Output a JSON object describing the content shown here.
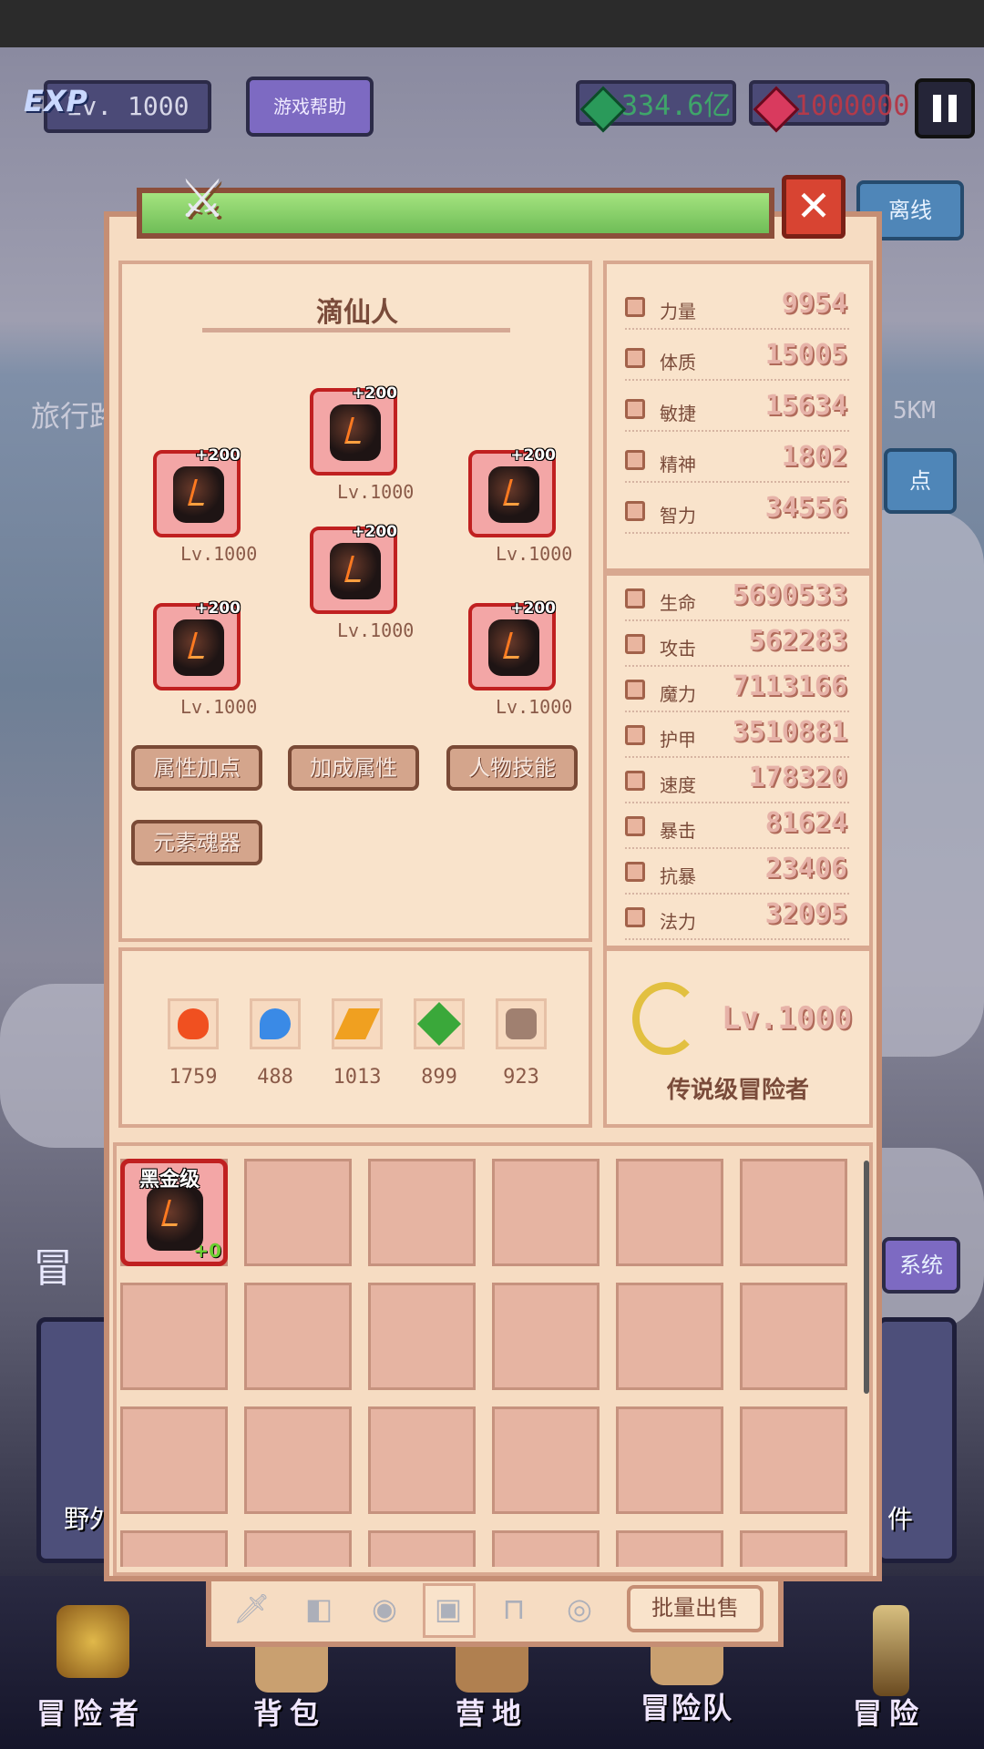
{
  "topbar": {
    "exp_label": "EXP",
    "level": "Lv. 1000",
    "help_label": "游戏帮助",
    "currency_green": "334.6亿",
    "currency_red": "1000000"
  },
  "background": {
    "offline_label": "离线",
    "travel_label": "旅行路",
    "distance": "5KM",
    "point_label": "点",
    "adventure_partial": "冒",
    "system_label": "系统",
    "left_card_label": "野外",
    "right_card_label": "件"
  },
  "character": {
    "name": "滴仙人",
    "equipment": [
      {
        "id": "weapon",
        "plus": "+200",
        "level": "Lv.1000"
      },
      {
        "id": "helmet",
        "plus": "+200",
        "level": "Lv.1000"
      },
      {
        "id": "shield",
        "plus": "+200",
        "level": "Lv.1000"
      },
      {
        "id": "armor",
        "plus": "+200",
        "level": "Lv.1000"
      },
      {
        "id": "gloves",
        "plus": "+200",
        "level": "Lv.1000"
      },
      {
        "id": "boots",
        "plus": "+200",
        "level": "Lv.1000"
      }
    ],
    "buttons": {
      "attr_points": "属性加点",
      "bonus_attr": "加成属性",
      "char_skills": "人物技能",
      "element_soul": "元素魂器"
    },
    "resources": [
      {
        "icon": "fire-essence-icon",
        "value": "1759"
      },
      {
        "icon": "water-essence-icon",
        "value": "488"
      },
      {
        "icon": "lightning-essence-icon",
        "value": "1013"
      },
      {
        "icon": "nature-essence-icon",
        "value": "899"
      },
      {
        "icon": "skull-essence-icon",
        "value": "923"
      }
    ]
  },
  "base_stats": [
    {
      "label": "力量",
      "value": "9954"
    },
    {
      "label": "体质",
      "value": "15005"
    },
    {
      "label": "敏捷",
      "value": "15634"
    },
    {
      "label": "精神",
      "value": "1802"
    },
    {
      "label": "智力",
      "value": "34556"
    }
  ],
  "combat_stats": [
    {
      "label": "生命",
      "value": "5690533"
    },
    {
      "label": "攻击",
      "value": "562283"
    },
    {
      "label": "魔力",
      "value": "7113166"
    },
    {
      "label": "护甲",
      "value": "3510881"
    },
    {
      "label": "速度",
      "value": "178320"
    },
    {
      "label": "暴击",
      "value": "81624"
    },
    {
      "label": "抗暴",
      "value": "23406"
    },
    {
      "label": "法力",
      "value": "32095"
    }
  ],
  "rank": {
    "level": "Lv.1000",
    "title": "传说级冒险者"
  },
  "inventory": {
    "first_item": {
      "rank": "黑金级",
      "plus": "+0"
    }
  },
  "tabs": {
    "bulk_sell": "批量出售"
  },
  "bottom_nav": [
    {
      "label": "冒险者"
    },
    {
      "label": "背包"
    },
    {
      "label": "营地"
    },
    {
      "label": "冒险队"
    },
    {
      "label": "冒险"
    }
  ],
  "colors": {
    "panel_bg": "#f6dcc2",
    "slot_border": "#c02020",
    "header_green": "#8fd66f",
    "close_red": "#d84432"
  }
}
